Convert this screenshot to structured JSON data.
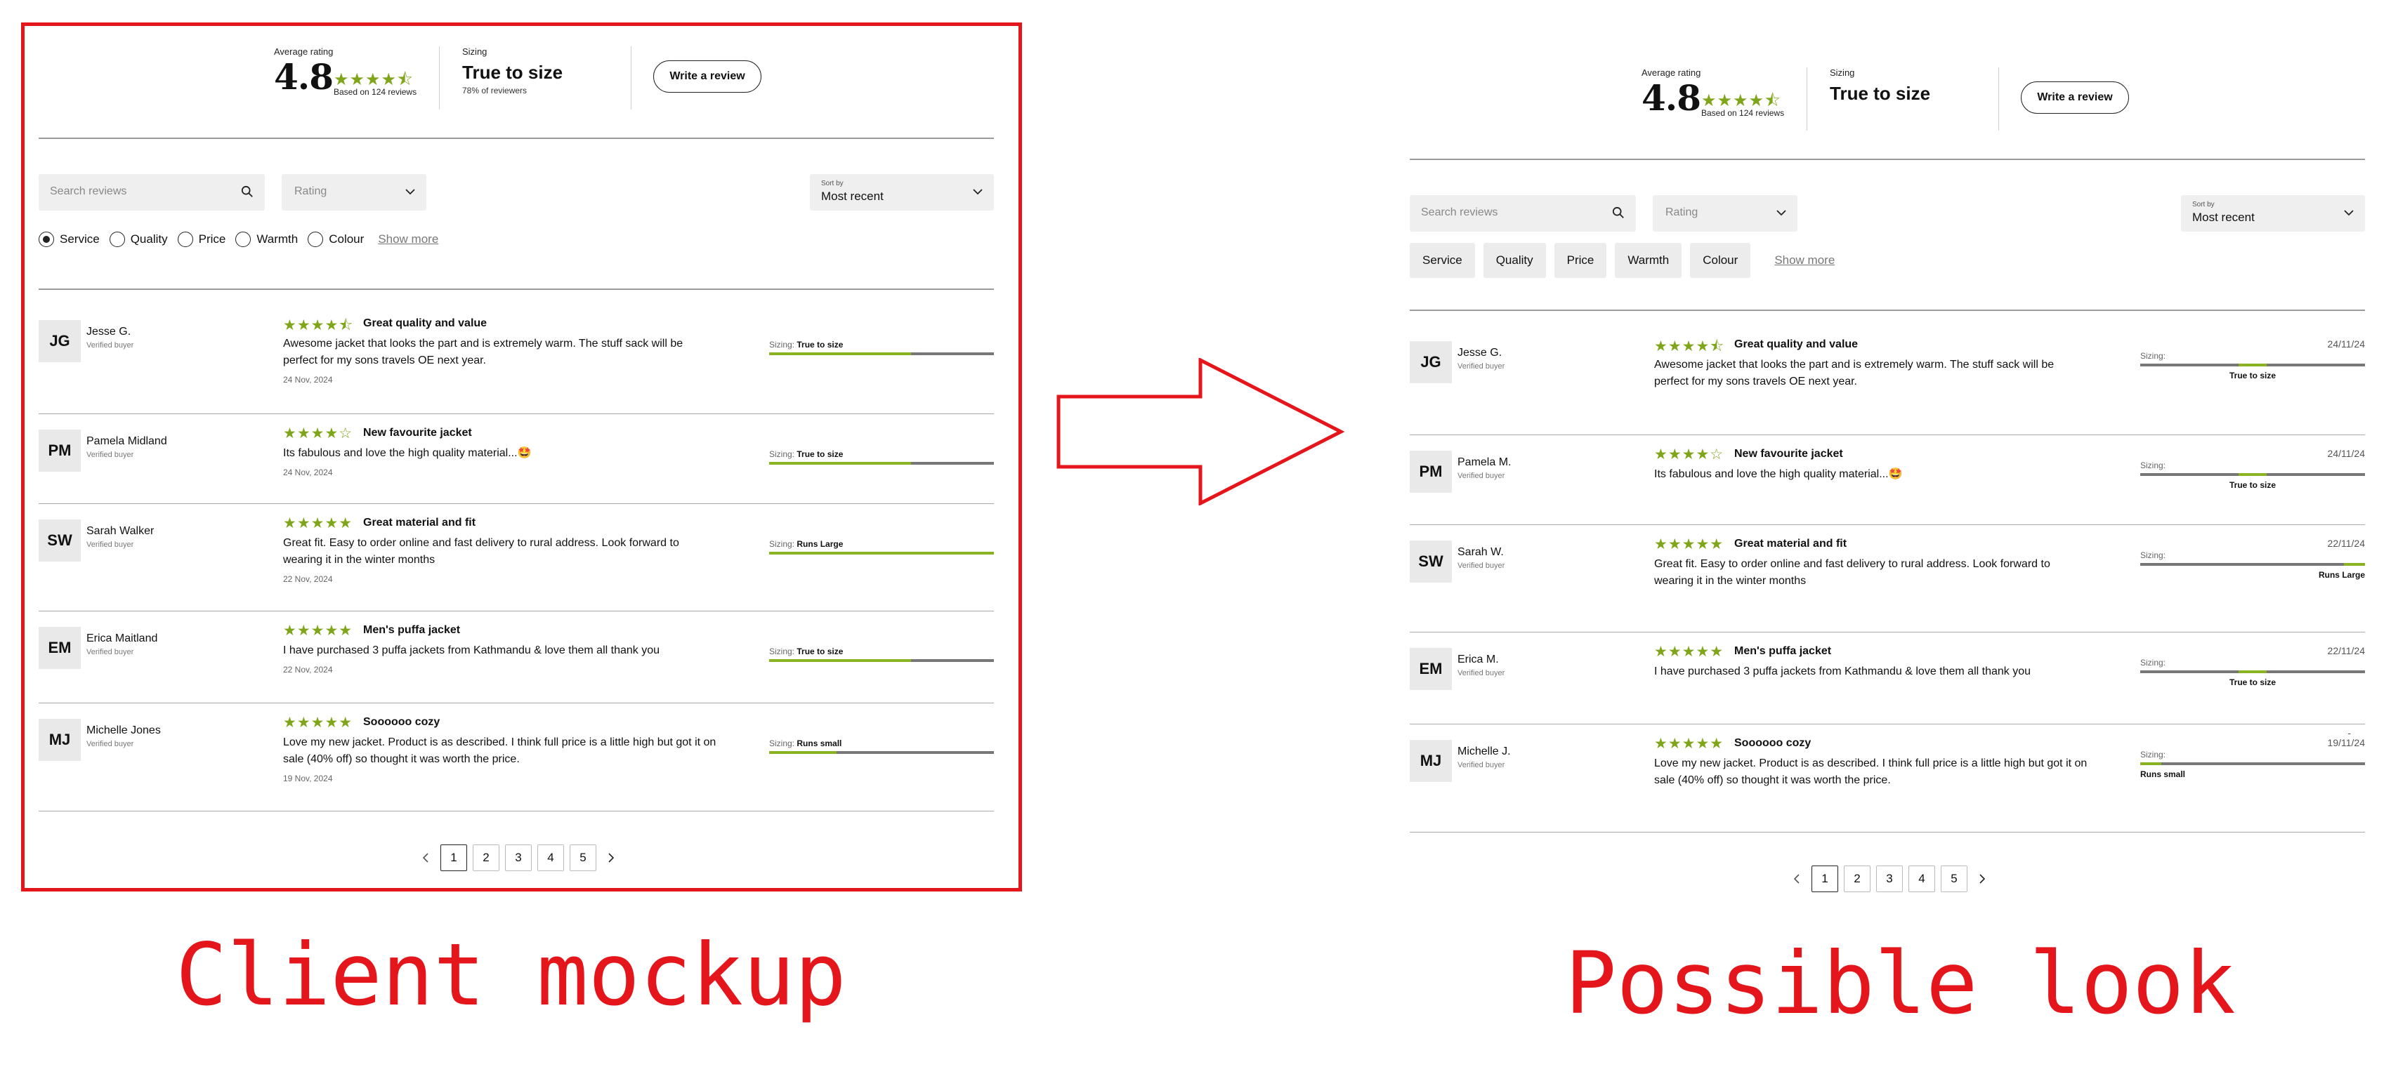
{
  "captions": {
    "left": "Client mockup",
    "right": "Possible look"
  },
  "colors": {
    "accent_red": "#e4161b",
    "star_green": "#7fa51a",
    "bar_green": "#8ab321"
  },
  "summary": {
    "avg_label": "Average rating",
    "avg_value": "4.8",
    "avg_stars": "★★★★⯪",
    "based_on": "Based on 124 reviews",
    "sizing_label": "Sizing",
    "sizing_value": "True to size",
    "sizing_sub": "78% of reviewers",
    "write_review": "Write a review"
  },
  "filters": {
    "search_placeholder": "Search reviews",
    "rating_placeholder": "Rating",
    "sort_label": "Sort by",
    "sort_value": "Most recent",
    "tags": [
      "Service",
      "Quality",
      "Price",
      "Warmth",
      "Colour"
    ],
    "selected_tag": "Service",
    "show_more": "Show more"
  },
  "sizing_prefix": "Sizing:",
  "mockup_reviews": [
    {
      "initials": "JG",
      "name": "Jesse G.",
      "verified": "Verified buyer",
      "stars": "★★★★⯪",
      "title": "Great quality and value",
      "body": "Awesome jacket that looks the part and is extremely warm. The stuff sack will be perfect for my sons travels OE next year.",
      "date": "24 Nov, 2024",
      "sizing": "True to size",
      "fill_pct": 63
    },
    {
      "initials": "PM",
      "name": "Pamela Midland",
      "verified": "Verified buyer",
      "stars": "★★★★☆",
      "title": "New favourite jacket",
      "body": "Its fabulous and love the high quality material...🤩",
      "date": "24 Nov, 2024",
      "sizing": "True to size",
      "fill_pct": 63
    },
    {
      "initials": "SW",
      "name": "Sarah Walker",
      "verified": "Verified buyer",
      "stars": "★★★★★",
      "title": "Great material and fit",
      "body": "Great fit. Easy to order online and fast delivery to rural address. Look forward to wearing it in the winter months",
      "date": "22 Nov, 2024",
      "sizing": "Runs Large",
      "fill_pct": 100
    },
    {
      "initials": "EM",
      "name": "Erica Maitland",
      "verified": "Verified buyer",
      "stars": "★★★★★",
      "title": "Men's puffa jacket",
      "body": "I have purchased 3 puffa jackets from Kathmandu & love them all thank you",
      "date": "22 Nov, 2024",
      "sizing": "True to size",
      "fill_pct": 63
    },
    {
      "initials": "MJ",
      "name": "Michelle Jones",
      "verified": "Verified buyer",
      "stars": "★★★★★",
      "title": "Soooooo cozy",
      "body": "Love my new jacket. Product is as described. I think full price is a little high but got it on sale (40% off) so thought it was worth the price.",
      "date": "19 Nov, 2024",
      "sizing": "Runs small",
      "fill_pct": 30
    }
  ],
  "look_reviews": [
    {
      "initials": "JG",
      "name": "Jesse G.",
      "verified": "Verified buyer",
      "stars": "★★★★⯪",
      "title": "Great quality and value",
      "body": "Awesome jacket that looks the part and is extremely warm. The stuff sack will be perfect for my sons travels OE next year.",
      "date": "24/11/24",
      "sizing": "True to size",
      "marker": "center"
    },
    {
      "initials": "PM",
      "name": "Pamela M.",
      "verified": "Verified buyer",
      "stars": "★★★★☆",
      "title": "New favourite jacket",
      "body": "Its fabulous and love the high quality material...🤩",
      "date": "24/11/24",
      "sizing": "True to size",
      "marker": "center"
    },
    {
      "initials": "SW",
      "name": "Sarah W.",
      "verified": "Verified buyer",
      "stars": "★★★★★",
      "title": "Great material and fit",
      "body": "Great fit. Easy to order online and fast delivery to rural address. Look forward to wearing it in the winter months",
      "date": "22/11/24",
      "sizing": "Runs Large",
      "marker": "right"
    },
    {
      "initials": "EM",
      "name": "Erica M.",
      "verified": "Verified buyer",
      "stars": "★★★★★",
      "title": "Men's puffa jacket",
      "body": "I have purchased 3 puffa jackets from Kathmandu & love them all thank you",
      "date": "22/11/24",
      "sizing": "True to size",
      "marker": "center"
    },
    {
      "initials": "MJ",
      "name": "Michelle J.",
      "verified": "Verified buyer",
      "stars": "★★★★★",
      "title": "Soooooo cozy",
      "body": "Love my new jacket. Product is as described. I think full price is a little high but got it on sale (40% off) so thought it was worth the price.",
      "date": "19/11/24",
      "sizing": "Runs small",
      "marker": "left",
      "extra_mark": "-"
    }
  ],
  "pagination": {
    "pages": [
      "1",
      "2",
      "3",
      "4",
      "5"
    ],
    "current": "1"
  }
}
